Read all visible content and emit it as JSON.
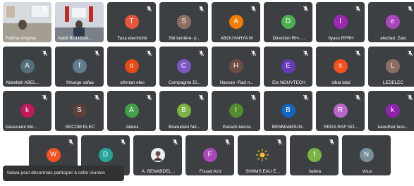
{
  "tiles": [
    {
      "name": "Fatima Amghar",
      "type": "video",
      "mic_muted": true
    },
    {
      "name": "Nabil BOUSSA...",
      "type": "video",
      "mic_muted": false
    },
    {
      "name": "Taza electricité",
      "initial": "T",
      "color": "#e8553c",
      "mic_muted": true
    },
    {
      "name": "Sté lumière- p...",
      "initial": "S",
      "color": "#8d6e63",
      "mic_muted": true
    },
    {
      "name": "ABOUYAHYA M",
      "initial": "A",
      "color": "#f57c00",
      "mic_muted": true
    },
    {
      "name": "Direction RH- ...",
      "initial": "D",
      "color": "#4caf50",
      "mic_muted": true
    },
    {
      "name": "Ilyass RFRH",
      "initial": "I",
      "color": "#9c27b0",
      "mic_muted": true
    },
    {
      "name": "elecfad. Zaki",
      "initial": "e",
      "color": "#ab47bc",
      "mic_muted": true
    },
    {
      "name": "Abdellah ABEL...",
      "initial": "A",
      "color": "#546e7a",
      "mic_muted": true
    },
    {
      "name": "frituege safaa",
      "initial": "f",
      "color": "#607d8b",
      "mic_muted": true
    },
    {
      "name": "othman elec",
      "initial": "o",
      "color": "#e64a19",
      "mic_muted": true
    },
    {
      "name": "Compagnie El...",
      "initial": "C",
      "color": "#7e57c2",
      "mic_muted": true
    },
    {
      "name": "Hassan -Rad n...",
      "initial": "H",
      "color": "#6d4c41",
      "mic_muted": true
    },
    {
      "name": "Ets NOUVTECH",
      "initial": "E",
      "color": "#673ab7",
      "mic_muted": true
    },
    {
      "name": "sibai talal",
      "initial": "s",
      "color": "#f4511e",
      "mic_muted": true
    },
    {
      "name": "LEDELEC",
      "initial": "L",
      "color": "#8d6e63",
      "mic_muted": true
    },
    {
      "name": "kassouani Mo...",
      "initial": "k",
      "color": "#c2185b",
      "mic_muted": true
    },
    {
      "name": "SECOM ELEC",
      "initial": "S",
      "color": "#5d4037",
      "mic_muted": true
    },
    {
      "name": "Alaoui",
      "initial": "A",
      "color": "#43a047",
      "mic_muted": true
    },
    {
      "name": "Braoudani fati...",
      "initial": "B",
      "color": "#7cb342",
      "mic_muted": true
    },
    {
      "name": "Iharach kenza",
      "initial": "I",
      "color": "#558b2f",
      "mic_muted": true
    },
    {
      "name": "BENMAMOUN...",
      "initial": "B",
      "color": "#1565c0",
      "mic_muted": true
    },
    {
      "name": "REDA RAF NO...",
      "initial": "R",
      "color": "#ba68c8",
      "mic_muted": true
    },
    {
      "name": "kaouthar less...",
      "initial": "k",
      "color": "#8e24aa",
      "mic_muted": true
    },
    {
      "name": "",
      "initial": "W",
      "color": "#f4511e",
      "mic_muted": true
    },
    {
      "name": "",
      "initial": "D",
      "color": "#26a69a",
      "mic_muted": true
    },
    {
      "name": "A. BENABDEL...",
      "type": "photo",
      "mic_muted": true
    },
    {
      "name": "Fouad Aziz",
      "initial": "F",
      "color": "#ab47bc",
      "mic_muted": true
    },
    {
      "name": "SHAMS EAU E...",
      "type": "logo",
      "mic_muted": true
    },
    {
      "name": "fadwa",
      "initial": "f",
      "color": "#7cb342",
      "mic_muted": true
    },
    {
      "name": "Vous",
      "initial": "N",
      "color": "#78909c",
      "mic_muted": false
    }
  ],
  "notification": "fadwa peut désormais participer à cette réunion"
}
